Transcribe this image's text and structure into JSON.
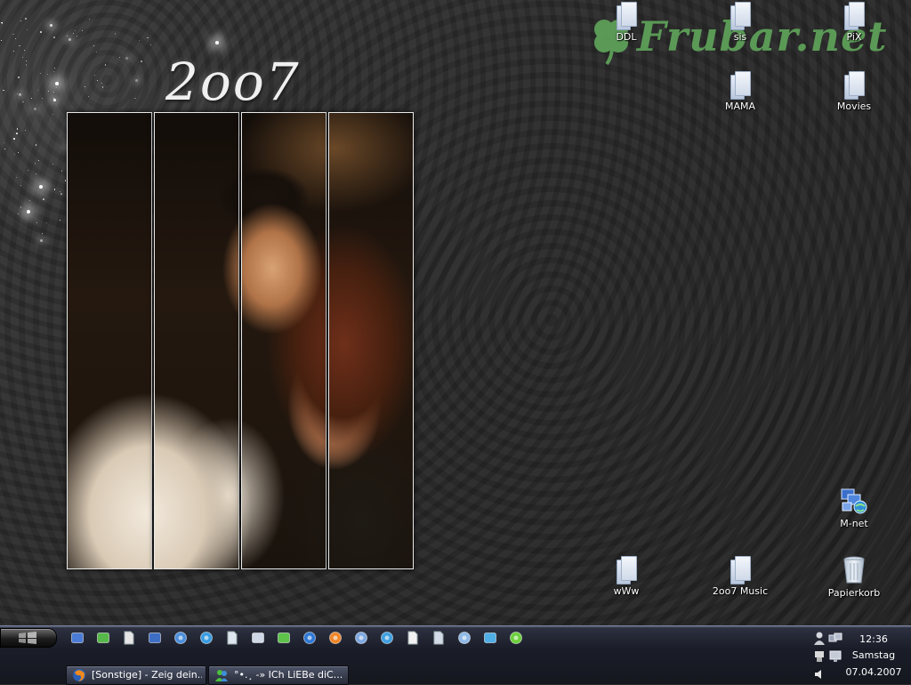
{
  "wallpaper": {
    "year_text": "2oo7",
    "watermark_text": "Frubar.net"
  },
  "desktop_icons": [
    {
      "name": "icon-ddl",
      "label": "DDL",
      "icon": "folder-icon"
    },
    {
      "name": "icon-sis",
      "label": "sis",
      "icon": "folder-icon"
    },
    {
      "name": "icon-pix",
      "label": "PiX",
      "icon": "folder-icon"
    },
    {
      "name": "icon-mama",
      "label": "MAMA",
      "icon": "folder-icon"
    },
    {
      "name": "icon-movies",
      "label": "Movies",
      "icon": "folder-icon"
    },
    {
      "name": "icon-m-net",
      "label": "M-net",
      "icon": "network-connection-icon"
    },
    {
      "name": "icon-www",
      "label": "wWw",
      "icon": "folder-icon"
    },
    {
      "name": "icon-2oo7-music",
      "label": "2oo7 Music",
      "icon": "folder-icon"
    },
    {
      "name": "icon-papierkorb",
      "label": "Papierkorb",
      "icon": "recycle-bin-icon"
    }
  ],
  "taskbar": {
    "quick_launch": [
      "show-desktop-icon",
      "messenger-icon",
      "notepad-icon",
      "my-computer-icon",
      "network-icon",
      "media-player-icon",
      "document-icon",
      "folder-icon",
      "gadget-icon",
      "internet-explorer-icon",
      "firefox-icon",
      "search-icon",
      "settings-icon",
      "blank-page-icon",
      "file-icon",
      "disc-icon",
      "msn-icon",
      "refresh-icon"
    ],
    "tasks": [
      {
        "label": "[Sonstige] - Zeig dein...",
        "icon": "firefox-icon"
      },
      {
        "label": "°•.¸ -» ICh LiEBe diC...",
        "icon": "msn-icon"
      }
    ]
  },
  "tray": {
    "time": "12:36",
    "day": "Samstag",
    "date": "07.04.2007",
    "icons": [
      "user-icon",
      "network-status-icon",
      "usb-icon",
      "display-icon",
      "volume-icon"
    ]
  },
  "colors": {
    "watermark": "#5fa35a",
    "taskbar": "#1a1d28"
  }
}
